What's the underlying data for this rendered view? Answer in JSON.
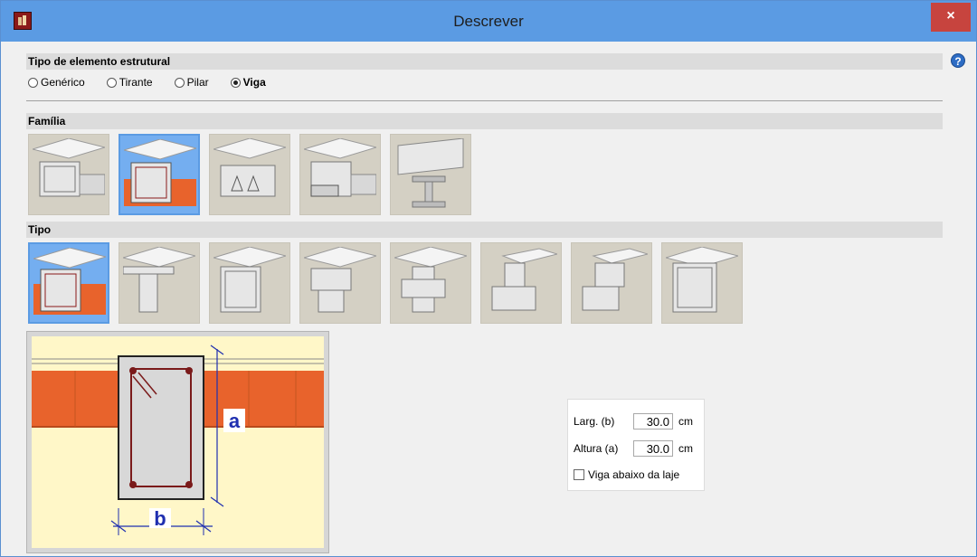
{
  "window": {
    "title": "Descrever",
    "close_label": "×",
    "help_label": "?"
  },
  "element_type": {
    "header": "Tipo de elemento estrutural",
    "options": [
      "Genérico",
      "Tirante",
      "Pilar",
      "Viga"
    ],
    "selected": "Viga"
  },
  "family": {
    "header": "Família",
    "items": [
      "rectangular-beam",
      "rectangular-reinforced-beam",
      "prestressed-beam",
      "steel-connector-beam",
      "steel-i-beam"
    ],
    "selected_index": 1
  },
  "type": {
    "header": "Tipo",
    "items": [
      "rectangular",
      "t-section",
      "box",
      "double-t",
      "cross",
      "l-left",
      "l-right",
      "inverted"
    ],
    "selected_index": 0
  },
  "preview": {
    "label_a": "a",
    "label_b": "b"
  },
  "dimensions": {
    "width_label": "Larg. (b)",
    "width_value": "30.0",
    "height_label": "Altura (a)",
    "height_value": "30.0",
    "unit": "cm",
    "below_slab_label": "Viga abaixo da laje",
    "below_slab_checked": false
  },
  "colors": {
    "titlebar": "#5b9be3",
    "close": "#c7443e",
    "selection": "#74aef0",
    "slab": "#e8632c",
    "rebar": "#8b1a1a",
    "dimension": "#1f2fb0"
  }
}
